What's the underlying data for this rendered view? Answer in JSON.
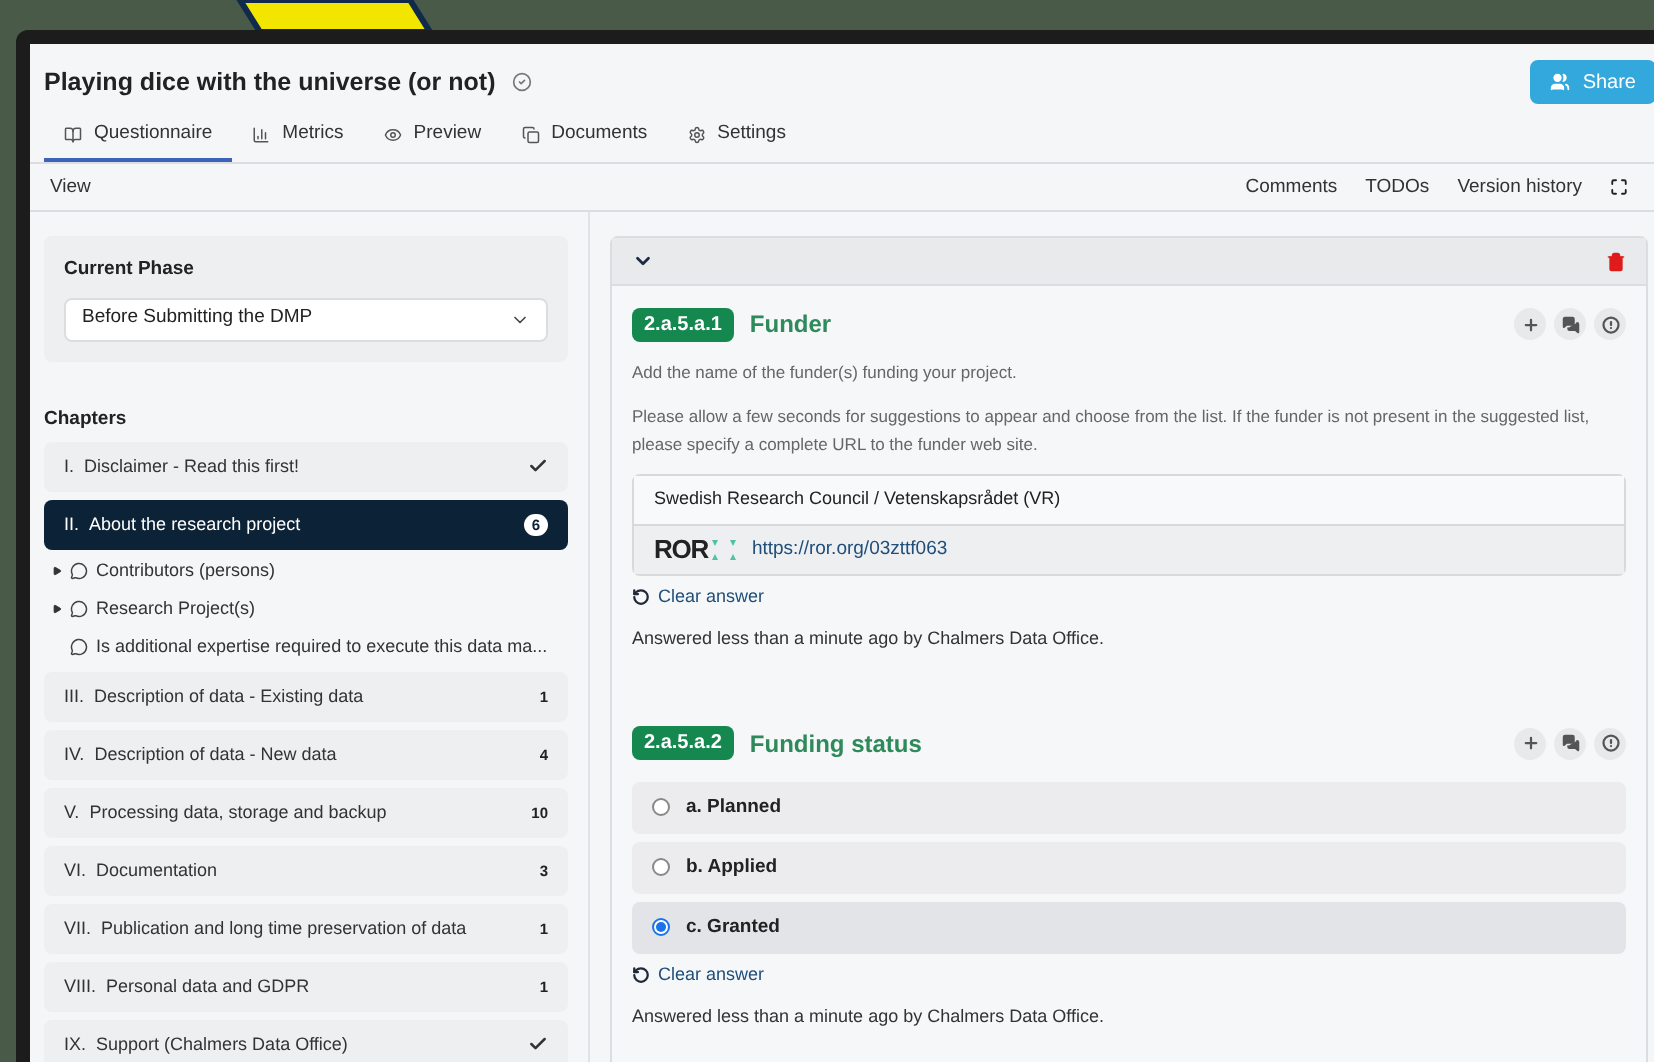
{
  "window": {
    "title": "Playing dice with the universe (or not)",
    "share_button": "Share"
  },
  "tabs": [
    {
      "label": "Questionnaire",
      "selected": true
    },
    {
      "label": "Metrics",
      "selected": false
    },
    {
      "label": "Preview",
      "selected": false
    },
    {
      "label": "Documents",
      "selected": false
    },
    {
      "label": "Settings",
      "selected": false
    }
  ],
  "toolbar": {
    "view": "View",
    "actions": [
      "Comments",
      "TODOs",
      "Version history"
    ]
  },
  "sidebar": {
    "phase_label": "Current Phase",
    "phase_value": "Before Submitting the DMP",
    "chapters_label": "Chapters",
    "chapters": [
      {
        "number": "I.",
        "title": "Disclaimer - Read this first!",
        "kind": "check",
        "selected": false
      },
      {
        "number": "II.",
        "title": "About the research project",
        "kind": "count",
        "count": "6",
        "selected": true,
        "children": [
          {
            "label": "Contributors (persons)",
            "kind": "group"
          },
          {
            "label": "Research Project(s)",
            "kind": "group"
          },
          {
            "label": "Is additional expertise required to execute this data ma...",
            "kind": "question"
          }
        ]
      },
      {
        "number": "III.",
        "title": "Description of data - Existing data",
        "kind": "count",
        "count": "1",
        "selected": false
      },
      {
        "number": "IV.",
        "title": "Description of data - New data",
        "kind": "count",
        "count": "4",
        "selected": false
      },
      {
        "number": "V.",
        "title": "Processing data, storage and backup",
        "kind": "count",
        "count": "10",
        "selected": false
      },
      {
        "number": "VI.",
        "title": "Documentation",
        "kind": "count",
        "count": "3",
        "selected": false
      },
      {
        "number": "VII.",
        "title": "Publication and long time preservation of data",
        "kind": "count",
        "count": "1",
        "selected": false
      },
      {
        "number": "VIII.",
        "title": "Personal data and GDPR",
        "kind": "count",
        "count": "1",
        "selected": false
      },
      {
        "number": "IX.",
        "title": "Support (Chalmers Data Office)",
        "kind": "check",
        "selected": false
      }
    ]
  },
  "questions": [
    {
      "kind": "integration",
      "number": "2.a.5.a.1",
      "title": "Funder",
      "description": [
        "Add the name of the funder(s) funding your project.",
        "Please allow a few seconds for suggestions to appear and choose from the list. If the funder is not present in the suggested list, please specify a complete URL to the funder web site."
      ],
      "answer": "Swedish Research Council / Vetenskapsrådet (VR)",
      "logo": "ROR",
      "link": "https://ror.org/03zttf063",
      "clear": "Clear answer",
      "answered": "Answered less than a minute ago by Chalmers Data Office."
    },
    {
      "kind": "options",
      "number": "2.a.5.a.2",
      "title": "Funding status",
      "options": [
        {
          "label": "a. Planned",
          "selected": false
        },
        {
          "label": "b. Applied",
          "selected": false
        },
        {
          "label": "c. Granted",
          "selected": true
        }
      ],
      "clear": "Clear answer",
      "answered": "Answered less than a minute ago by Chalmers Data Office."
    }
  ]
}
